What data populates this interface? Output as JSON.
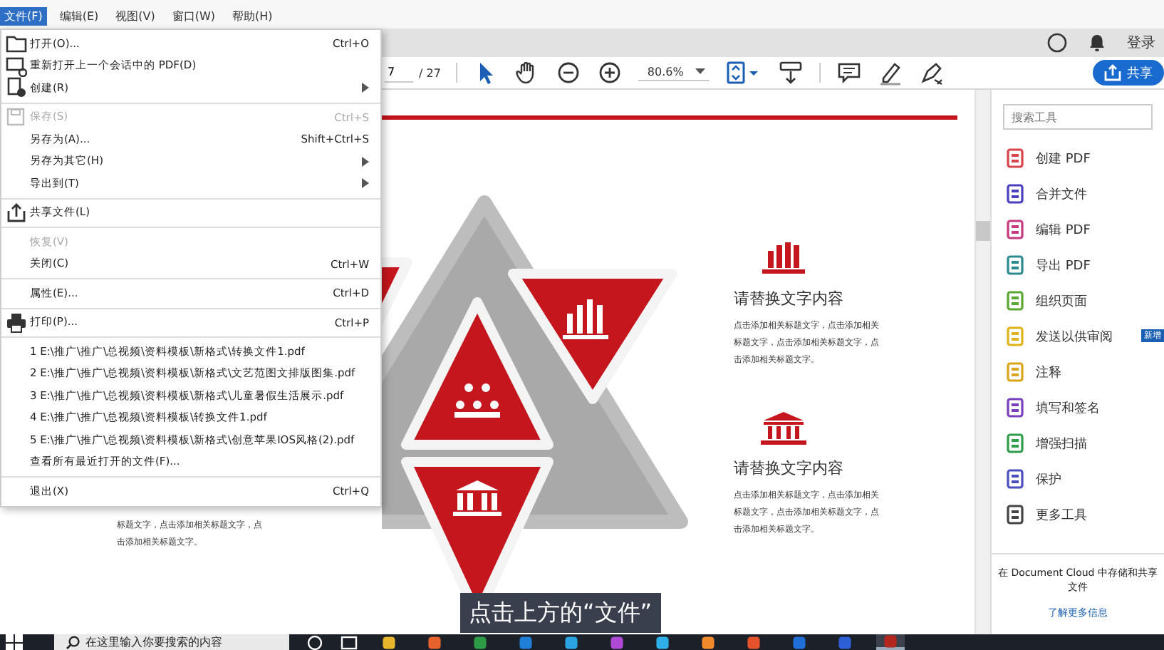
{
  "menubar": [
    {
      "label": "文件(F)",
      "selected": true
    },
    {
      "label": "编辑(E)",
      "selected": false
    },
    {
      "label": "视图(V)",
      "selected": false
    },
    {
      "label": "窗口(W)",
      "selected": false
    },
    {
      "label": "帮助(H)",
      "selected": false
    }
  ],
  "header": {
    "sign_in": "登录"
  },
  "toolbar": {
    "page": "7",
    "page_total": "/ 27",
    "zoom": "80.6%",
    "tools": [
      {
        "selected": true
      },
      {
        "selected": false
      },
      {
        "selected": false
      },
      {
        "selected": false
      }
    ],
    "share": "共享"
  },
  "file_menu": {
    "groups": [
      [
        {
          "label": "打开(O)...",
          "shortcut": "Ctrl+O",
          "submenu": false,
          "disabled": false
        },
        {
          "label": "重新打开上一个会话中的 PDF(D)",
          "submenu": false,
          "disabled": false
        },
        {
          "label": "创建(R)",
          "submenu": true,
          "disabled": false
        }
      ],
      [
        {
          "label": "保存(S)",
          "shortcut": "Ctrl+S",
          "submenu": false,
          "disabled": true
        },
        {
          "label": "另存为(A)...",
          "shortcut": "Shift+Ctrl+S",
          "submenu": false,
          "disabled": false
        },
        {
          "label": "另存为其它(H)",
          "submenu": true,
          "disabled": false
        },
        {
          "label": "导出到(T)",
          "submenu": true,
          "disabled": false
        }
      ],
      [
        {
          "label": "共享文件(L)",
          "submenu": false,
          "disabled": false
        }
      ],
      [
        {
          "label": "恢复(V)",
          "submenu": false,
          "disabled": true
        },
        {
          "label": "关闭(C)",
          "shortcut": "Ctrl+W",
          "submenu": false,
          "disabled": false
        }
      ],
      [
        {
          "label": "属性(E)...",
          "shortcut": "Ctrl+D",
          "submenu": false,
          "disabled": false
        }
      ],
      [
        {
          "label": "打印(P)...",
          "shortcut": "Ctrl+P",
          "submenu": false,
          "disabled": false
        }
      ],
      [
        {
          "label": "1 E:\\推广\\推广\\总视频\\资料模板\\新格式\\转换文件1.pdf",
          "submenu": false,
          "disabled": false
        },
        {
          "label": "2 E:\\推广\\推广\\总视频\\资料模板\\新格式\\文艺范图文排版图集.pdf",
          "submenu": false,
          "disabled": false
        },
        {
          "label": "3 E:\\推广\\推广\\总视频\\资料模板\\新格式\\儿童暑假生活展示.pdf",
          "submenu": false,
          "disabled": false
        },
        {
          "label": "4 E:\\推广\\推广\\总视频\\资料模板\\转换文件1.pdf",
          "submenu": false,
          "disabled": false
        },
        {
          "label": "5 E:\\推广\\推广\\总视频\\资料模板\\新格式\\创意苹果IOS风格(2).pdf",
          "submenu": false,
          "disabled": false
        },
        {
          "label": "查看所有最近打开的文件(F)...",
          "submenu": false,
          "disabled": false
        }
      ],
      [
        {
          "label": "退出(X)",
          "shortcut": "Ctrl+Q",
          "submenu": false,
          "disabled": false
        }
      ]
    ]
  },
  "slide": {
    "left_text": "标题文字，点击添加相关标题文字，点击添加相关标题文字。",
    "items": [
      {
        "heading": "请替换文字内容",
        "body": "点击添加相关标题文字，点击添加相关标题文字，点击添加相关标题文字，点击添加相关标题文字。"
      },
      {
        "heading": "请替换文字内容",
        "body": "点击添加相关标题文字，点击添加相关标题文字，点击添加相关标题文字，点击添加相关标题文字。"
      }
    ]
  },
  "tools_panel": {
    "search": {
      "placeholder": "搜索工具"
    },
    "tools": [
      {
        "label": "创建 PDF",
        "color": "#d9434b"
      },
      {
        "label": "合并文件",
        "color": "#4a3fbf"
      },
      {
        "label": "编辑 PDF",
        "color": "#c53a7e"
      },
      {
        "label": "导出 PDF",
        "color": "#2a8a8f"
      },
      {
        "label": "组织页面",
        "color": "#5aa832"
      },
      {
        "label": "发送以供审阅",
        "color": "#e0b21a",
        "badge": "新增"
      },
      {
        "label": "注释",
        "color": "#d9a51a"
      },
      {
        "label": "填写和签名",
        "color": "#7a3fbf"
      },
      {
        "label": "增强扫描",
        "color": "#2f9e4a"
      },
      {
        "label": "保护",
        "color": "#4a4fc0"
      },
      {
        "label": "更多工具",
        "color": "#444444"
      }
    ],
    "cloud_note": "在 Document Cloud 中存储和共享文件",
    "learn_more": "了解更多信息"
  },
  "caption": "点击上方的“文件”",
  "taskbar": {
    "search": {
      "placeholder": "在这里输入你要搜索的内容"
    },
    "apps": [
      {
        "color": "#e8b62c",
        "selected": false
      },
      {
        "color": "#e8632c",
        "selected": false
      },
      {
        "color": "#2d9b45",
        "selected": false
      },
      {
        "color": "#1f7fd6",
        "selected": false
      },
      {
        "color": "#2aa3e0",
        "selected": false
      },
      {
        "color": "#b04ad6",
        "selected": false
      },
      {
        "color": "#30b0e8",
        "selected": false
      },
      {
        "color": "#f08a2a",
        "selected": false
      },
      {
        "color": "#e5532d",
        "selected": false
      },
      {
        "color": "#1f6fd6",
        "selected": false
      },
      {
        "color": "#2d5fd6",
        "selected": false
      },
      {
        "color": "#b3261e",
        "selected": true
      }
    ]
  }
}
